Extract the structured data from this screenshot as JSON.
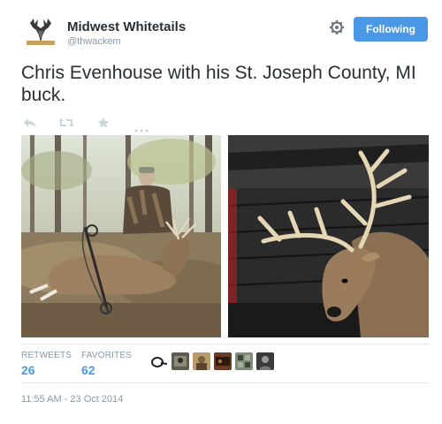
{
  "account": {
    "name": "Midwest Whitetails",
    "handle": "@thwackem"
  },
  "follow_button": {
    "label": "Following"
  },
  "tweet": {
    "text": "Chris Evenhouse with his St. Joseph County, MI buck."
  },
  "actions": {
    "icons": [
      "reply-icon",
      "retweet-icon",
      "favorite-icon",
      "more-icon"
    ]
  },
  "stats": {
    "retweets_label": "RETWEETS",
    "retweets_count": "26",
    "favorites_label": "FAVORITES",
    "favorites_count": "62"
  },
  "timestamp": "11:55 AM - 23 Oct 2014",
  "colors": {
    "accent": "#4a99e9",
    "text": "#292f33",
    "muted": "#8899a6",
    "divider": "#e1e8ed"
  }
}
